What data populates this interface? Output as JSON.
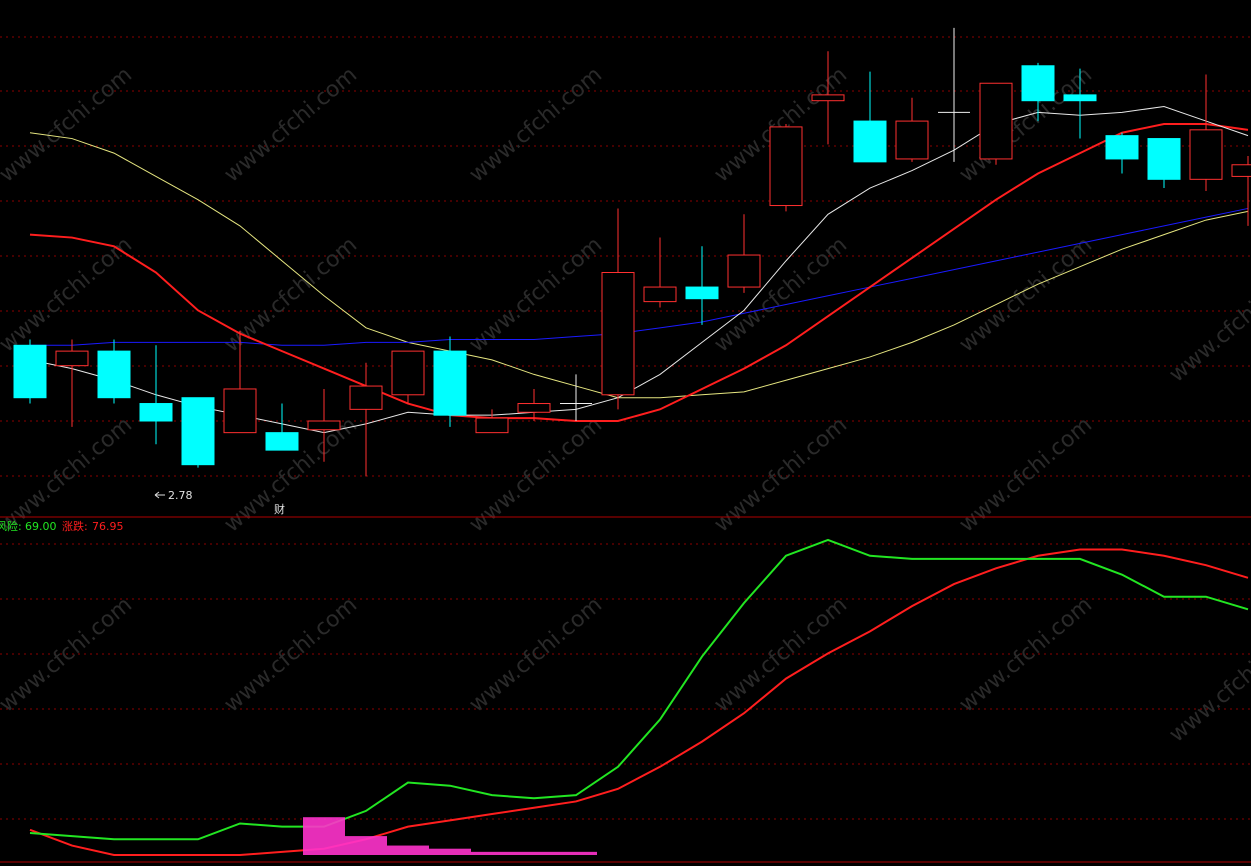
{
  "price_panel": {
    "low_marker_text": "2.78",
    "event_label": "财"
  },
  "indicator_panel": {
    "risk_label": "风险:",
    "risk_value": "69.00",
    "rise_label": "涨跌:",
    "rise_value": "76.95"
  },
  "watermark_text": "www.cfchi.com",
  "colors": {
    "background": "#000000",
    "grid": "#8b0000",
    "up": "#ff3030",
    "down": "#00ffff",
    "ma_white": "#e8e8e8",
    "ma_red": "#ff1e1e",
    "ma_blue": "#1a1aff",
    "ma_yellow": "#e6e680",
    "risk_line": "#22e622",
    "rise_line": "#ff1e1e",
    "histogram": "#ff33cc"
  },
  "chart_data": {
    "type": "candlestick",
    "candles": [
      {
        "open": 3.2,
        "close": 3.02,
        "high": 3.22,
        "low": 3.0
      },
      {
        "open": 3.13,
        "close": 3.18,
        "high": 3.22,
        "low": 2.92
      },
      {
        "open": 3.18,
        "close": 3.02,
        "high": 3.22,
        "low": 3.0
      },
      {
        "open": 3.0,
        "close": 2.94,
        "high": 3.2,
        "low": 2.86
      },
      {
        "open": 3.02,
        "close": 2.79,
        "high": 3.02,
        "low": 2.78
      },
      {
        "open": 2.9,
        "close": 3.05,
        "high": 3.25,
        "low": 2.9
      },
      {
        "open": 2.9,
        "close": 2.84,
        "high": 3.0,
        "low": 2.84
      },
      {
        "open": 2.91,
        "close": 2.94,
        "high": 3.05,
        "low": 2.8
      },
      {
        "open": 2.98,
        "close": 3.06,
        "high": 3.14,
        "low": 2.75
      },
      {
        "open": 3.03,
        "close": 3.18,
        "high": 3.18,
        "low": 3.0
      },
      {
        "open": 3.18,
        "close": 2.96,
        "high": 3.23,
        "low": 2.92
      },
      {
        "open": 2.9,
        "close": 2.95,
        "high": 2.98,
        "low": 2.9
      },
      {
        "open": 2.97,
        "close": 3.0,
        "high": 3.05,
        "low": 2.94
      },
      {
        "open": 3.0,
        "close": 3.0,
        "high": 3.1,
        "low": 2.94
      },
      {
        "open": 3.03,
        "close": 3.45,
        "high": 3.67,
        "low": 2.98
      },
      {
        "open": 3.35,
        "close": 3.4,
        "high": 3.57,
        "low": 3.33
      },
      {
        "open": 3.4,
        "close": 3.36,
        "high": 3.54,
        "low": 3.27
      },
      {
        "open": 3.4,
        "close": 3.51,
        "high": 3.65,
        "low": 3.38
      },
      {
        "open": 3.68,
        "close": 3.95,
        "high": 3.96,
        "low": 3.66
      },
      {
        "open": 4.04,
        "close": 4.06,
        "high": 4.21,
        "low": 3.89
      },
      {
        "open": 3.97,
        "close": 3.83,
        "high": 4.14,
        "low": 3.83
      },
      {
        "open": 3.84,
        "close": 3.97,
        "high": 4.05,
        "low": 3.83
      },
      {
        "open": 4.0,
        "close": 4.0,
        "high": 4.29,
        "low": 3.83
      },
      {
        "open": 3.84,
        "close": 4.1,
        "high": 4.1,
        "low": 3.82
      },
      {
        "open": 4.16,
        "close": 4.04,
        "high": 4.17,
        "low": 3.97
      },
      {
        "open": 4.06,
        "close": 4.04,
        "high": 4.15,
        "low": 3.91
      },
      {
        "open": 3.92,
        "close": 3.84,
        "high": 3.93,
        "low": 3.79
      },
      {
        "open": 3.91,
        "close": 3.77,
        "high": 3.91,
        "low": 3.74
      },
      {
        "open": 3.77,
        "close": 3.94,
        "high": 4.13,
        "low": 3.73
      },
      {
        "open": 3.78,
        "close": 3.82,
        "high": 3.85,
        "low": 3.61
      }
    ],
    "ma_white": [
      3.15,
      3.12,
      3.08,
      3.03,
      2.99,
      2.96,
      2.93,
      2.9,
      2.93,
      2.97,
      2.96,
      2.96,
      2.97,
      2.98,
      3.02,
      3.1,
      3.21,
      3.32,
      3.49,
      3.65,
      3.74,
      3.8,
      3.87,
      3.96,
      4.0,
      3.99,
      4.0,
      4.02,
      3.97,
      3.92
    ],
    "ma_red": [
      3.58,
      3.57,
      3.54,
      3.45,
      3.32,
      3.24,
      3.18,
      3.12,
      3.06,
      3.0,
      2.96,
      2.95,
      2.95,
      2.94,
      2.94,
      2.98,
      3.05,
      3.12,
      3.2,
      3.3,
      3.4,
      3.5,
      3.6,
      3.7,
      3.79,
      3.86,
      3.93,
      3.96,
      3.96,
      3.94
    ],
    "ma_blue": [
      3.2,
      3.2,
      3.21,
      3.21,
      3.21,
      3.21,
      3.2,
      3.2,
      3.21,
      3.21,
      3.22,
      3.22,
      3.22,
      3.23,
      3.24,
      3.26,
      3.28,
      3.31,
      3.34,
      3.37,
      3.4,
      3.43,
      3.46,
      3.49,
      3.52,
      3.55,
      3.58,
      3.61,
      3.64,
      3.67
    ],
    "ma_yellow": [
      3.93,
      3.91,
      3.86,
      3.78,
      3.7,
      3.61,
      3.49,
      3.37,
      3.26,
      3.21,
      3.18,
      3.15,
      3.1,
      3.06,
      3.02,
      3.02,
      3.03,
      3.04,
      3.08,
      3.12,
      3.16,
      3.21,
      3.27,
      3.34,
      3.41,
      3.47,
      3.53,
      3.58,
      3.63,
      3.66
    ],
    "price_ylim": [
      2.6,
      4.3
    ],
    "risk_line": [
      7,
      6,
      5,
      5,
      5,
      10,
      9,
      9,
      14,
      23,
      22,
      19,
      18,
      19,
      28,
      43,
      63,
      80,
      95,
      100,
      95,
      94,
      94,
      94,
      94,
      94,
      89,
      82,
      82,
      78
    ],
    "rise_line": [
      8,
      3,
      0,
      0,
      0,
      0,
      1,
      2,
      5,
      9,
      11,
      13,
      15,
      17,
      21,
      28,
      36,
      45,
      56,
      64,
      71,
      79,
      86,
      91,
      95,
      97,
      97,
      95,
      92,
      88
    ],
    "histogram": [
      0,
      0,
      0,
      0,
      0,
      0,
      0,
      12,
      6,
      3,
      2,
      1,
      1,
      1,
      0,
      0,
      0,
      0,
      0,
      0,
      0,
      0,
      0,
      0,
      0,
      0,
      0,
      0,
      0,
      0
    ],
    "indicator_ylim": [
      0,
      100
    ]
  }
}
